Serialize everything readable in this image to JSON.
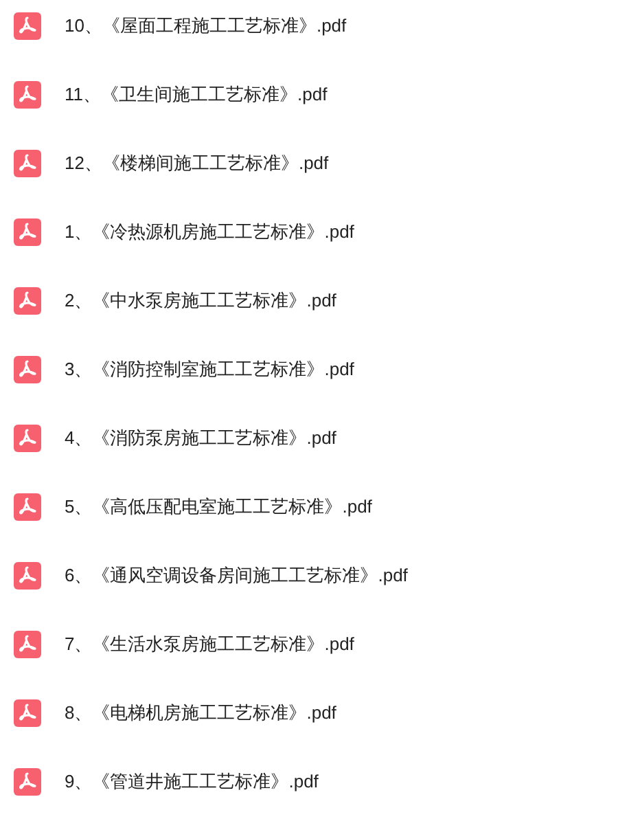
{
  "files": [
    {
      "name": "10、《屋面工程施工工艺标准》.pdf"
    },
    {
      "name": "11、《卫生间施工工艺标准》.pdf"
    },
    {
      "name": "12、《楼梯间施工工艺标准》.pdf"
    },
    {
      "name": "1、《冷热源机房施工工艺标准》.pdf"
    },
    {
      "name": "2、《中水泵房施工工艺标准》.pdf"
    },
    {
      "name": "3、《消防控制室施工工艺标准》.pdf"
    },
    {
      "name": "4、《消防泵房施工工艺标准》.pdf"
    },
    {
      "name": "5、《高低压配电室施工工艺标准》.pdf"
    },
    {
      "name": "6、《通风空调设备房间施工工艺标准》.pdf"
    },
    {
      "name": "7、《生活水泵房施工工艺标准》.pdf"
    },
    {
      "name": "8、《电梯机房施工工艺标准》.pdf"
    },
    {
      "name": "9、《管道井施工工艺标准》.pdf"
    }
  ]
}
